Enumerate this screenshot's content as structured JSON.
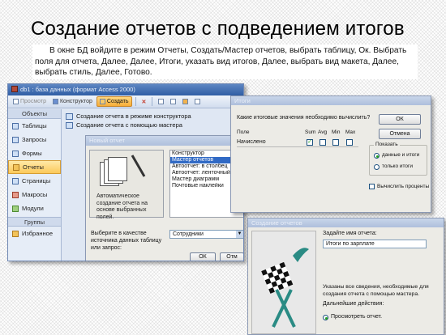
{
  "slide": {
    "title": "Создание отчетов с подведением итогов",
    "description": "В окне БД войдите в режим Отчеты, Создать/Мастер отчетов, выбрать таблицу, Ок. Выбрать поля для отчета, Далее, Далее, Итоги, указать вид итогов, Далее, выбрать вид макета, Далее, выбрать стиль, Далее, Готово."
  },
  "main_window": {
    "title": "db1 : база данных (формат Access 2000)",
    "toolbar": {
      "preview_label": "Просмотр",
      "designer_label": "Конструктор",
      "create_label": "Создать"
    },
    "sidebar": {
      "header": "Объекты",
      "items": [
        {
          "label": "Таблицы",
          "icon": "table-icon"
        },
        {
          "label": "Запросы",
          "icon": "query-icon"
        },
        {
          "label": "Формы",
          "icon": "form-icon"
        },
        {
          "label": "Отчеты",
          "icon": "report-icon",
          "selected": true
        },
        {
          "label": "Страницы",
          "icon": "page-icon"
        },
        {
          "label": "Макросы",
          "icon": "macro-icon"
        },
        {
          "label": "Модули",
          "icon": "module-icon"
        }
      ],
      "groups_header": "Группы",
      "favorites_label": "Избранное"
    },
    "objects": [
      "Создание отчета в режиме конструктора",
      "Создание отчета с помощью мастера"
    ]
  },
  "new_report_dialog": {
    "title": "Новый отчет",
    "preview_text": "Автоматическое создание отчета на основе выбранных полей.",
    "options": [
      {
        "label": "Конструктор",
        "selected": false
      },
      {
        "label": "Мастер отчетов",
        "selected": true
      },
      {
        "label": "Автоотчет: в столбец",
        "selected": false
      },
      {
        "label": "Автоотчет: ленточный",
        "selected": false
      },
      {
        "label": "Мастер диаграмм",
        "selected": false
      },
      {
        "label": "Почтовые наклейки",
        "selected": false
      }
    ],
    "source_label": "Выберите в качестве источника данных таблицу или запрос:",
    "source_value": "Сотрудники",
    "ok_label": "ОК",
    "cancel_label": "Отм"
  },
  "totals_dialog": {
    "title": "Итоги",
    "question": "Какие итоговые значения необходимо вычислить?",
    "columns": [
      "Поле",
      "Sum",
      "Avg",
      "Min",
      "Max"
    ],
    "rows": [
      {
        "field": "Начислено",
        "sum": true,
        "avg": false,
        "min": false,
        "max": false
      }
    ],
    "ok_label": "ОК",
    "cancel_label": "Отмена",
    "show_group_label": "Показать",
    "show_options": [
      {
        "label": "данные и итоги",
        "selected": true
      },
      {
        "label": "только итоги",
        "selected": false
      }
    ],
    "percent_label": "Вычислить проценты"
  },
  "wizard_dialog": {
    "title": "Создание отчетов",
    "name_prompt": "Задайте имя отчета:",
    "report_name": "Итоги по зарплате",
    "info_text": "Указаны все сведения, необходимые для создания отчета с помощью мастера.",
    "next_actions_label": "Дальнейшие действия:",
    "preview_option": "Просмотреть отчет."
  }
}
